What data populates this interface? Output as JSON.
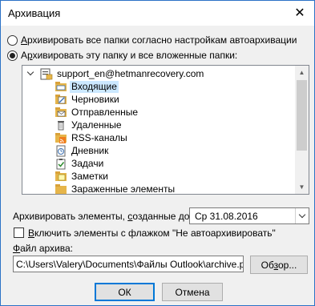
{
  "window": {
    "title": "Архивация",
    "close_glyph": "✕"
  },
  "options": {
    "archive_all": {
      "prefix": "",
      "hotkey": "А",
      "rest": "рхивировать все папки согласно настройкам автоархивации",
      "checked": false
    },
    "archive_this": {
      "prefix": "А",
      "hotkey": "р",
      "rest": "хивировать эту папку и все вложенные папки:",
      "checked": true
    }
  },
  "tree": {
    "account": "support_en@hetmanrecovery.com",
    "items": [
      {
        "label": "Входящие",
        "icon": "inbox-icon",
        "selected": true
      },
      {
        "label": "Черновики",
        "icon": "drafts-icon",
        "selected": false
      },
      {
        "label": "Отправленные",
        "icon": "sent-icon",
        "selected": false
      },
      {
        "label": "Удаленные",
        "icon": "trash-icon",
        "selected": false
      },
      {
        "label": "RSS-каналы",
        "icon": "rss-icon",
        "selected": false
      },
      {
        "label": "Дневник",
        "icon": "journal-icon",
        "selected": false
      },
      {
        "label": "Задачи",
        "icon": "tasks-icon",
        "selected": false
      },
      {
        "label": "Заметки",
        "icon": "notes-icon",
        "selected": false
      },
      {
        "label": "Зараженные элементы",
        "icon": "folder-icon",
        "selected": false
      }
    ]
  },
  "archive_before": {
    "label_pre": "Архивировать элементы, ",
    "label_hotkey": "с",
    "label_post": "озданные до:",
    "value": "Ср 31.08.2016"
  },
  "include_flag": {
    "hotkey": "В",
    "rest": "ключить элементы с флажком \"Не автоархивировать\"",
    "checked": false
  },
  "archive_file": {
    "label_hotkey": "Ф",
    "label_rest": "айл архива:",
    "value": "C:\\Users\\Valery\\Documents\\Файлы Outlook\\archive.pst",
    "browse_pre": "Об",
    "browse_hotkey": "з",
    "browse_post": "ор..."
  },
  "buttons": {
    "ok": "ОК",
    "cancel": "Отмена"
  }
}
